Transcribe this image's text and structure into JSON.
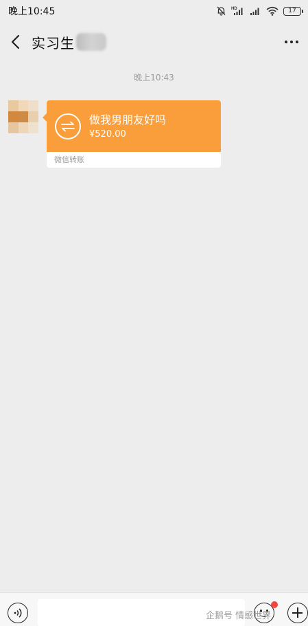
{
  "status_bar": {
    "time": "晚上10:45",
    "battery": "17",
    "icons": [
      "mute-bell-icon",
      "hd-signal-icon",
      "signal-icon",
      "wifi-icon",
      "battery-icon"
    ]
  },
  "header": {
    "back_icon": "chevron-left-icon",
    "title": "实习生",
    "more_icon": "more-dots-icon"
  },
  "chat": {
    "timestamp": "晚上10:43",
    "messages": [
      {
        "type": "transfer",
        "note": "做我男朋友好吗",
        "amount": "¥520.00",
        "footer": "微信转账",
        "icon": "transfer-arrows-icon",
        "color": "#fa9d3b"
      }
    ]
  },
  "input_bar": {
    "voice_icon": "voice-icon",
    "input_value": "",
    "emoji_icon": "emoji-icon",
    "plus_icon": "plus-icon"
  },
  "watermark": "企鹅号 情感世界",
  "colors": {
    "background": "#ededed",
    "transfer_orange": "#fa9d3b",
    "badge_red": "#f5453d"
  }
}
